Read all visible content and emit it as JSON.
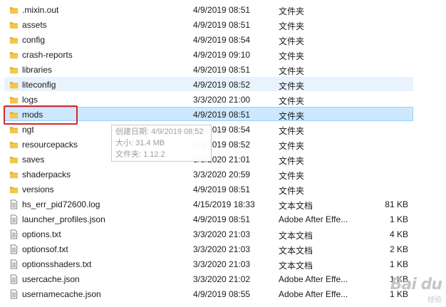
{
  "files": [
    {
      "name": ".mixin.out",
      "date": "4/9/2019 08:51",
      "type": "文件夹",
      "size": "",
      "icon": "folder-icon"
    },
    {
      "name": "assets",
      "date": "4/9/2019 08:51",
      "type": "文件夹",
      "size": "",
      "icon": "folder-icon"
    },
    {
      "name": "config",
      "date": "4/9/2019 08:54",
      "type": "文件夹",
      "size": "",
      "icon": "folder-icon"
    },
    {
      "name": "crash-reports",
      "date": "4/9/2019 09:10",
      "type": "文件夹",
      "size": "",
      "icon": "folder-icon"
    },
    {
      "name": "libraries",
      "date": "4/9/2019 08:51",
      "type": "文件夹",
      "size": "",
      "icon": "folder-icon"
    },
    {
      "name": "liteconfig",
      "date": "4/9/2019 08:52",
      "type": "文件夹",
      "size": "",
      "icon": "folder-icon"
    },
    {
      "name": "logs",
      "date": "3/3/2020 21:00",
      "type": "文件夹",
      "size": "",
      "icon": "folder-icon"
    },
    {
      "name": "mods",
      "date": "4/9/2019 08:51",
      "type": "文件夹",
      "size": "",
      "icon": "folder-icon"
    },
    {
      "name": "ngt",
      "date": "4/9/2019 08:54",
      "type": "文件夹",
      "size": "",
      "icon": "folder-icon"
    },
    {
      "name": "resourcepacks",
      "date": "4/9/2019 08:52",
      "type": "文件夹",
      "size": "",
      "icon": "folder-icon"
    },
    {
      "name": "saves",
      "date": "3/3/2020 21:01",
      "type": "文件夹",
      "size": "",
      "icon": "folder-icon"
    },
    {
      "name": "shaderpacks",
      "date": "3/3/2020 20:59",
      "type": "文件夹",
      "size": "",
      "icon": "folder-icon"
    },
    {
      "name": "versions",
      "date": "4/9/2019 08:51",
      "type": "文件夹",
      "size": "",
      "icon": "folder-icon"
    },
    {
      "name": "hs_err_pid72600.log",
      "date": "4/15/2019 18:33",
      "type": "文本文档",
      "size": "81 KB",
      "icon": "text-file-icon"
    },
    {
      "name": "launcher_profiles.json",
      "date": "4/9/2019 08:51",
      "type": "Adobe After Effe...",
      "size": "1 KB",
      "icon": "text-file-icon"
    },
    {
      "name": "options.txt",
      "date": "3/3/2020 21:03",
      "type": "文本文档",
      "size": "4 KB",
      "icon": "text-file-icon"
    },
    {
      "name": "optionsof.txt",
      "date": "3/3/2020 21:03",
      "type": "文本文档",
      "size": "2 KB",
      "icon": "text-file-icon"
    },
    {
      "name": "optionsshaders.txt",
      "date": "3/3/2020 21:03",
      "type": "文本文档",
      "size": "1 KB",
      "icon": "text-file-icon"
    },
    {
      "name": "usercache.json",
      "date": "3/3/2020 21:02",
      "type": "Adobe After Effe...",
      "size": "1 KB",
      "icon": "text-file-icon"
    },
    {
      "name": "usernamecache.json",
      "date": "4/9/2019 08:55",
      "type": "Adobe After Effe...",
      "size": "1 KB",
      "icon": "text-file-icon"
    }
  ],
  "selected_index": 7,
  "hover_index": 5,
  "tooltip": {
    "created": "创建日期: 4/9/2019 08:52",
    "size": "大小: 31.4 MB",
    "folder": "文件夹: 1.12.2"
  },
  "watermark": {
    "brand": "Bai du",
    "sub": "经验"
  },
  "colors": {
    "folder": "#f5c64a",
    "folder_dark": "#e0a82e",
    "selected_bg": "#cce8ff",
    "hover_bg": "#e8f3fd",
    "highlight_border": "#d9262a"
  }
}
